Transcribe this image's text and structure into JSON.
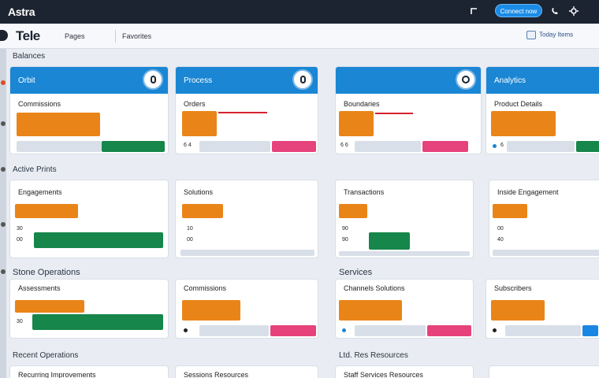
{
  "app": {
    "brand": "Astra",
    "cta": "Connect now"
  },
  "toolbar": {
    "title": "Tele",
    "tab1": "Pages",
    "tab2": "Favorites",
    "right": "Today Items"
  },
  "sections": {
    "s1": "Balances",
    "s2": "Active Prints",
    "s3a": "Stone Operations",
    "s3b": "Services",
    "s4a": "Recent Operations",
    "s4b": "Ltd. Res Resources"
  },
  "row1": [
    {
      "head": "Orbit",
      "sub": "Commissions",
      "vals": ""
    },
    {
      "head": "Process",
      "sub": "Orders",
      "vals": "6 4"
    },
    {
      "head": "",
      "sub": "Boundaries",
      "vals": "6 6"
    },
    {
      "head": "Analytics",
      "sub": "Product Details",
      "vals": "6"
    }
  ],
  "row2": [
    {
      "sub": "Engagements",
      "a": "30",
      "b": "00"
    },
    {
      "sub": "Solutions",
      "a": "10",
      "b": "00"
    },
    {
      "sub": "Transactions",
      "a": "90",
      "b": "90"
    },
    {
      "sub": "Inside Engagement",
      "a": "00",
      "b": "40"
    }
  ],
  "row3": [
    {
      "sub": "Assessments",
      "a": "30"
    },
    {
      "sub": "Commissions"
    },
    {
      "sub": "Channels Solutions"
    },
    {
      "sub": "Subscribers"
    }
  ],
  "row4": [
    {
      "sub": "Recurring Improvements"
    },
    {
      "sub": "Sessions Resources"
    },
    {
      "sub": "Staff Services Resources"
    }
  ]
}
